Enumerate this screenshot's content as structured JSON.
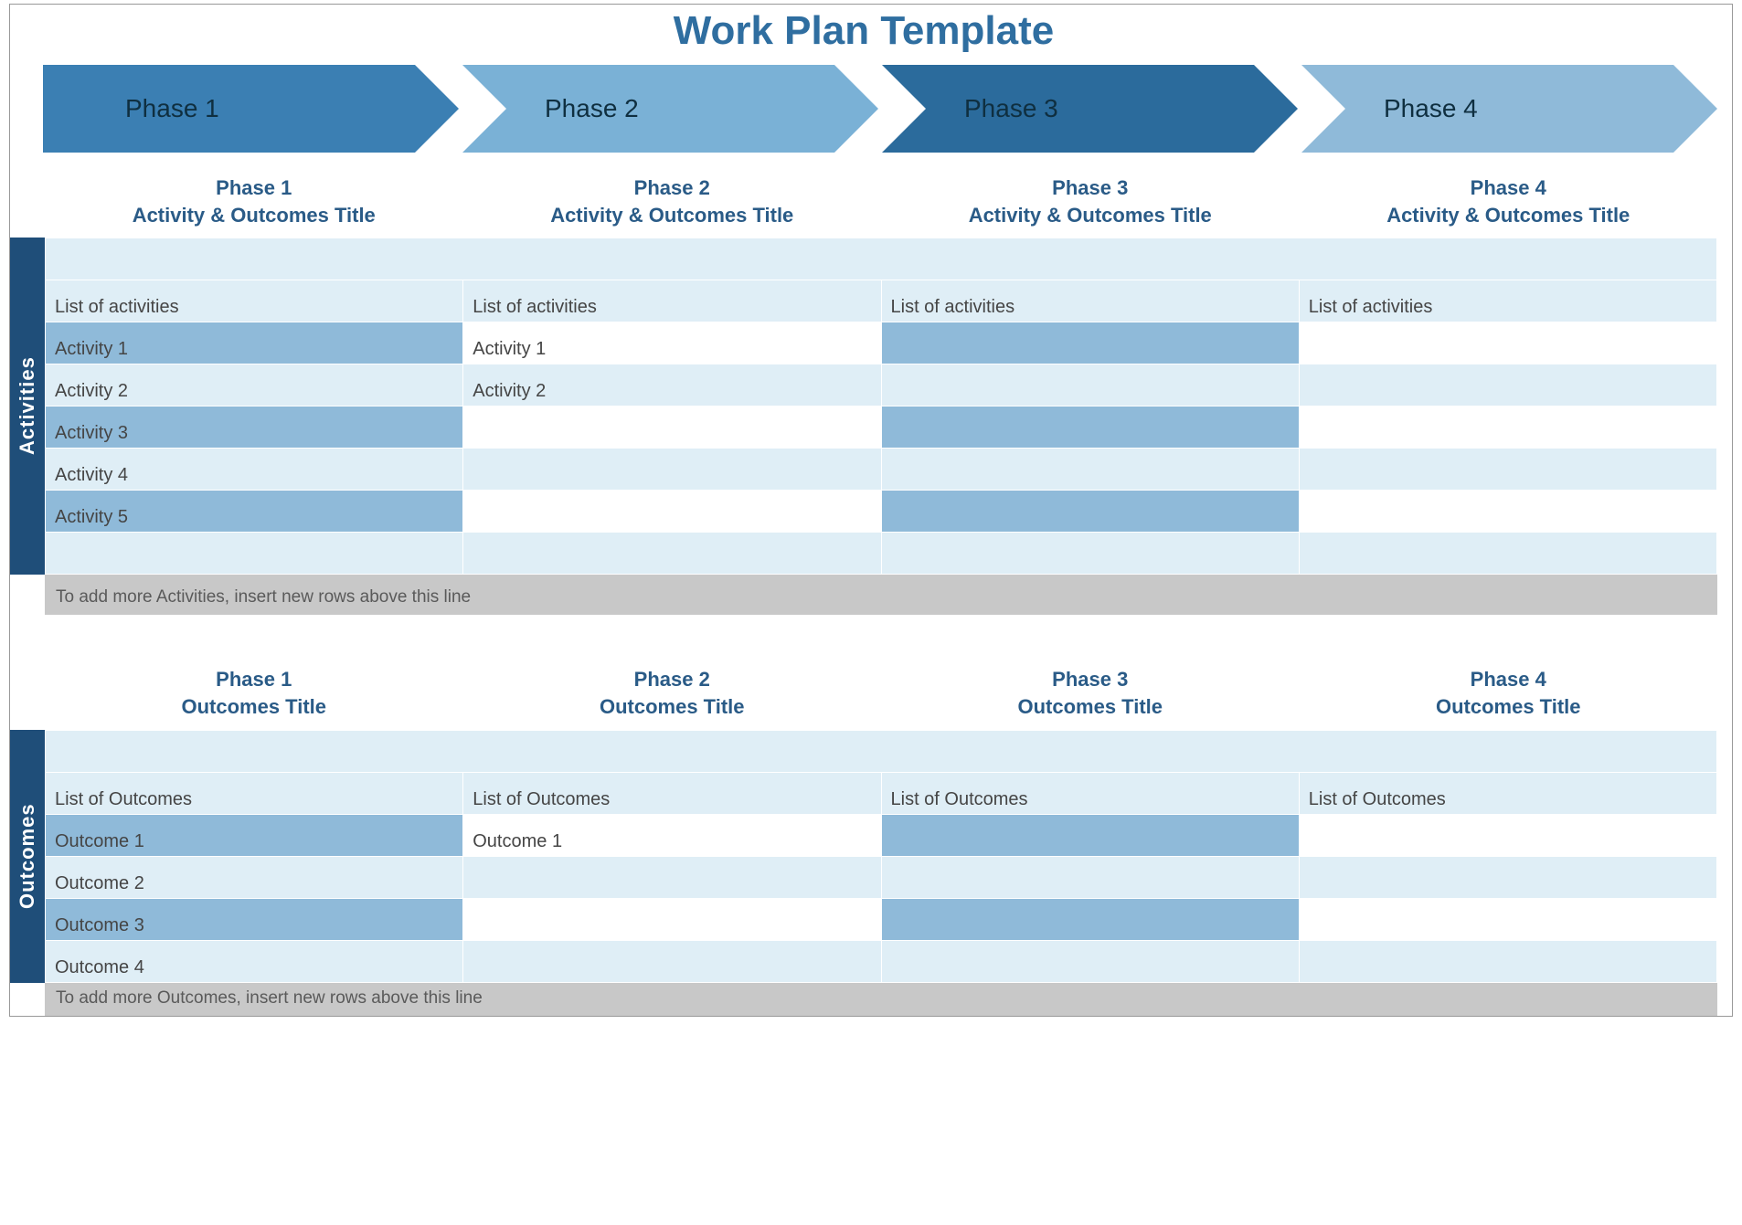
{
  "title": "Work Plan Template",
  "phases": [
    "Phase 1",
    "Phase 2",
    "Phase 3",
    "Phase 4"
  ],
  "activities": {
    "side_label": "Activities",
    "headers": [
      {
        "line1": "Phase 1",
        "line2": "Activity & Outcomes Title"
      },
      {
        "line1": "Phase 2",
        "line2": "Activity & Outcomes Title"
      },
      {
        "line1": "Phase 3",
        "line2": "Activity & Outcomes Title"
      },
      {
        "line1": "Phase 4",
        "line2": "Activity & Outcomes Title"
      }
    ],
    "rows": [
      {
        "style": [
          "light",
          "light",
          "light",
          "light"
        ],
        "cells": [
          "List of activities",
          "List of activities",
          "List of activities",
          "List of activities"
        ]
      },
      {
        "style": [
          "med",
          "white",
          "med",
          "white"
        ],
        "cells": [
          "Activity 1",
          "Activity 1",
          "",
          ""
        ]
      },
      {
        "style": [
          "light",
          "light",
          "light",
          "light"
        ],
        "cells": [
          "Activity 2",
          "Activity 2",
          "",
          ""
        ]
      },
      {
        "style": [
          "med",
          "white",
          "med",
          "white"
        ],
        "cells": [
          "Activity 3",
          "",
          "",
          ""
        ]
      },
      {
        "style": [
          "light",
          "light",
          "light",
          "light"
        ],
        "cells": [
          "Activity 4",
          "",
          "",
          ""
        ]
      },
      {
        "style": [
          "med",
          "white",
          "med",
          "white"
        ],
        "cells": [
          "Activity 5",
          "",
          "",
          ""
        ]
      },
      {
        "style": [
          "light",
          "light",
          "light",
          "light"
        ],
        "cells": [
          "",
          "",
          "",
          ""
        ]
      }
    ],
    "hint": "To add more Activities, insert new rows above this line"
  },
  "outcomes": {
    "side_label": "Outcomes",
    "headers": [
      {
        "line1": "Phase 1",
        "line2": "Outcomes Title"
      },
      {
        "line1": "Phase 2",
        "line2": "Outcomes Title"
      },
      {
        "line1": "Phase 3",
        "line2": "Outcomes Title"
      },
      {
        "line1": "Phase 4",
        "line2": "Outcomes Title"
      }
    ],
    "rows": [
      {
        "style": [
          "light",
          "light",
          "light",
          "light"
        ],
        "cells": [
          "List of Outcomes",
          "List of Outcomes",
          "List of Outcomes",
          "List of Outcomes"
        ]
      },
      {
        "style": [
          "med",
          "white",
          "med",
          "white"
        ],
        "cells": [
          "Outcome 1",
          "Outcome 1",
          "",
          ""
        ]
      },
      {
        "style": [
          "light",
          "light",
          "light",
          "light"
        ],
        "cells": [
          "Outcome 2",
          "",
          "",
          ""
        ]
      },
      {
        "style": [
          "med",
          "white",
          "med",
          "white"
        ],
        "cells": [
          "Outcome 3",
          "",
          "",
          ""
        ]
      },
      {
        "style": [
          "light",
          "light",
          "light",
          "light"
        ],
        "cells": [
          "Outcome 4",
          "",
          "",
          ""
        ]
      }
    ],
    "hint": "To add more Outcomes, insert new rows above this line"
  }
}
